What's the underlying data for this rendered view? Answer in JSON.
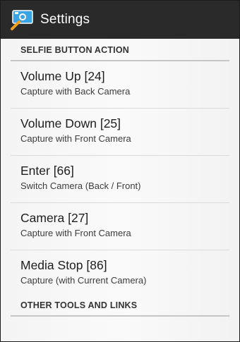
{
  "action_bar": {
    "title": "Settings",
    "icon": "selfie-stick-camera-icon"
  },
  "sections": [
    {
      "header": "SELFIE BUTTON ACTION",
      "items": [
        {
          "title": "Volume Up [24]",
          "summary": "Capture with Back Camera"
        },
        {
          "title": "Volume Down [25]",
          "summary": "Capture with Front Camera"
        },
        {
          "title": "Enter [66]",
          "summary": "Switch Camera (Back / Front)"
        },
        {
          "title": "Camera [27]",
          "summary": "Capture with Front Camera"
        },
        {
          "title": "Media Stop [86]",
          "summary": "Capture (with Current Camera)"
        }
      ]
    },
    {
      "header": "OTHER TOOLS AND LINKS",
      "items": []
    }
  ],
  "colors": {
    "action_bar_bg": "#2a2a2a",
    "icon_blue": "#3aa3e3",
    "icon_stick": "#f0a020"
  }
}
